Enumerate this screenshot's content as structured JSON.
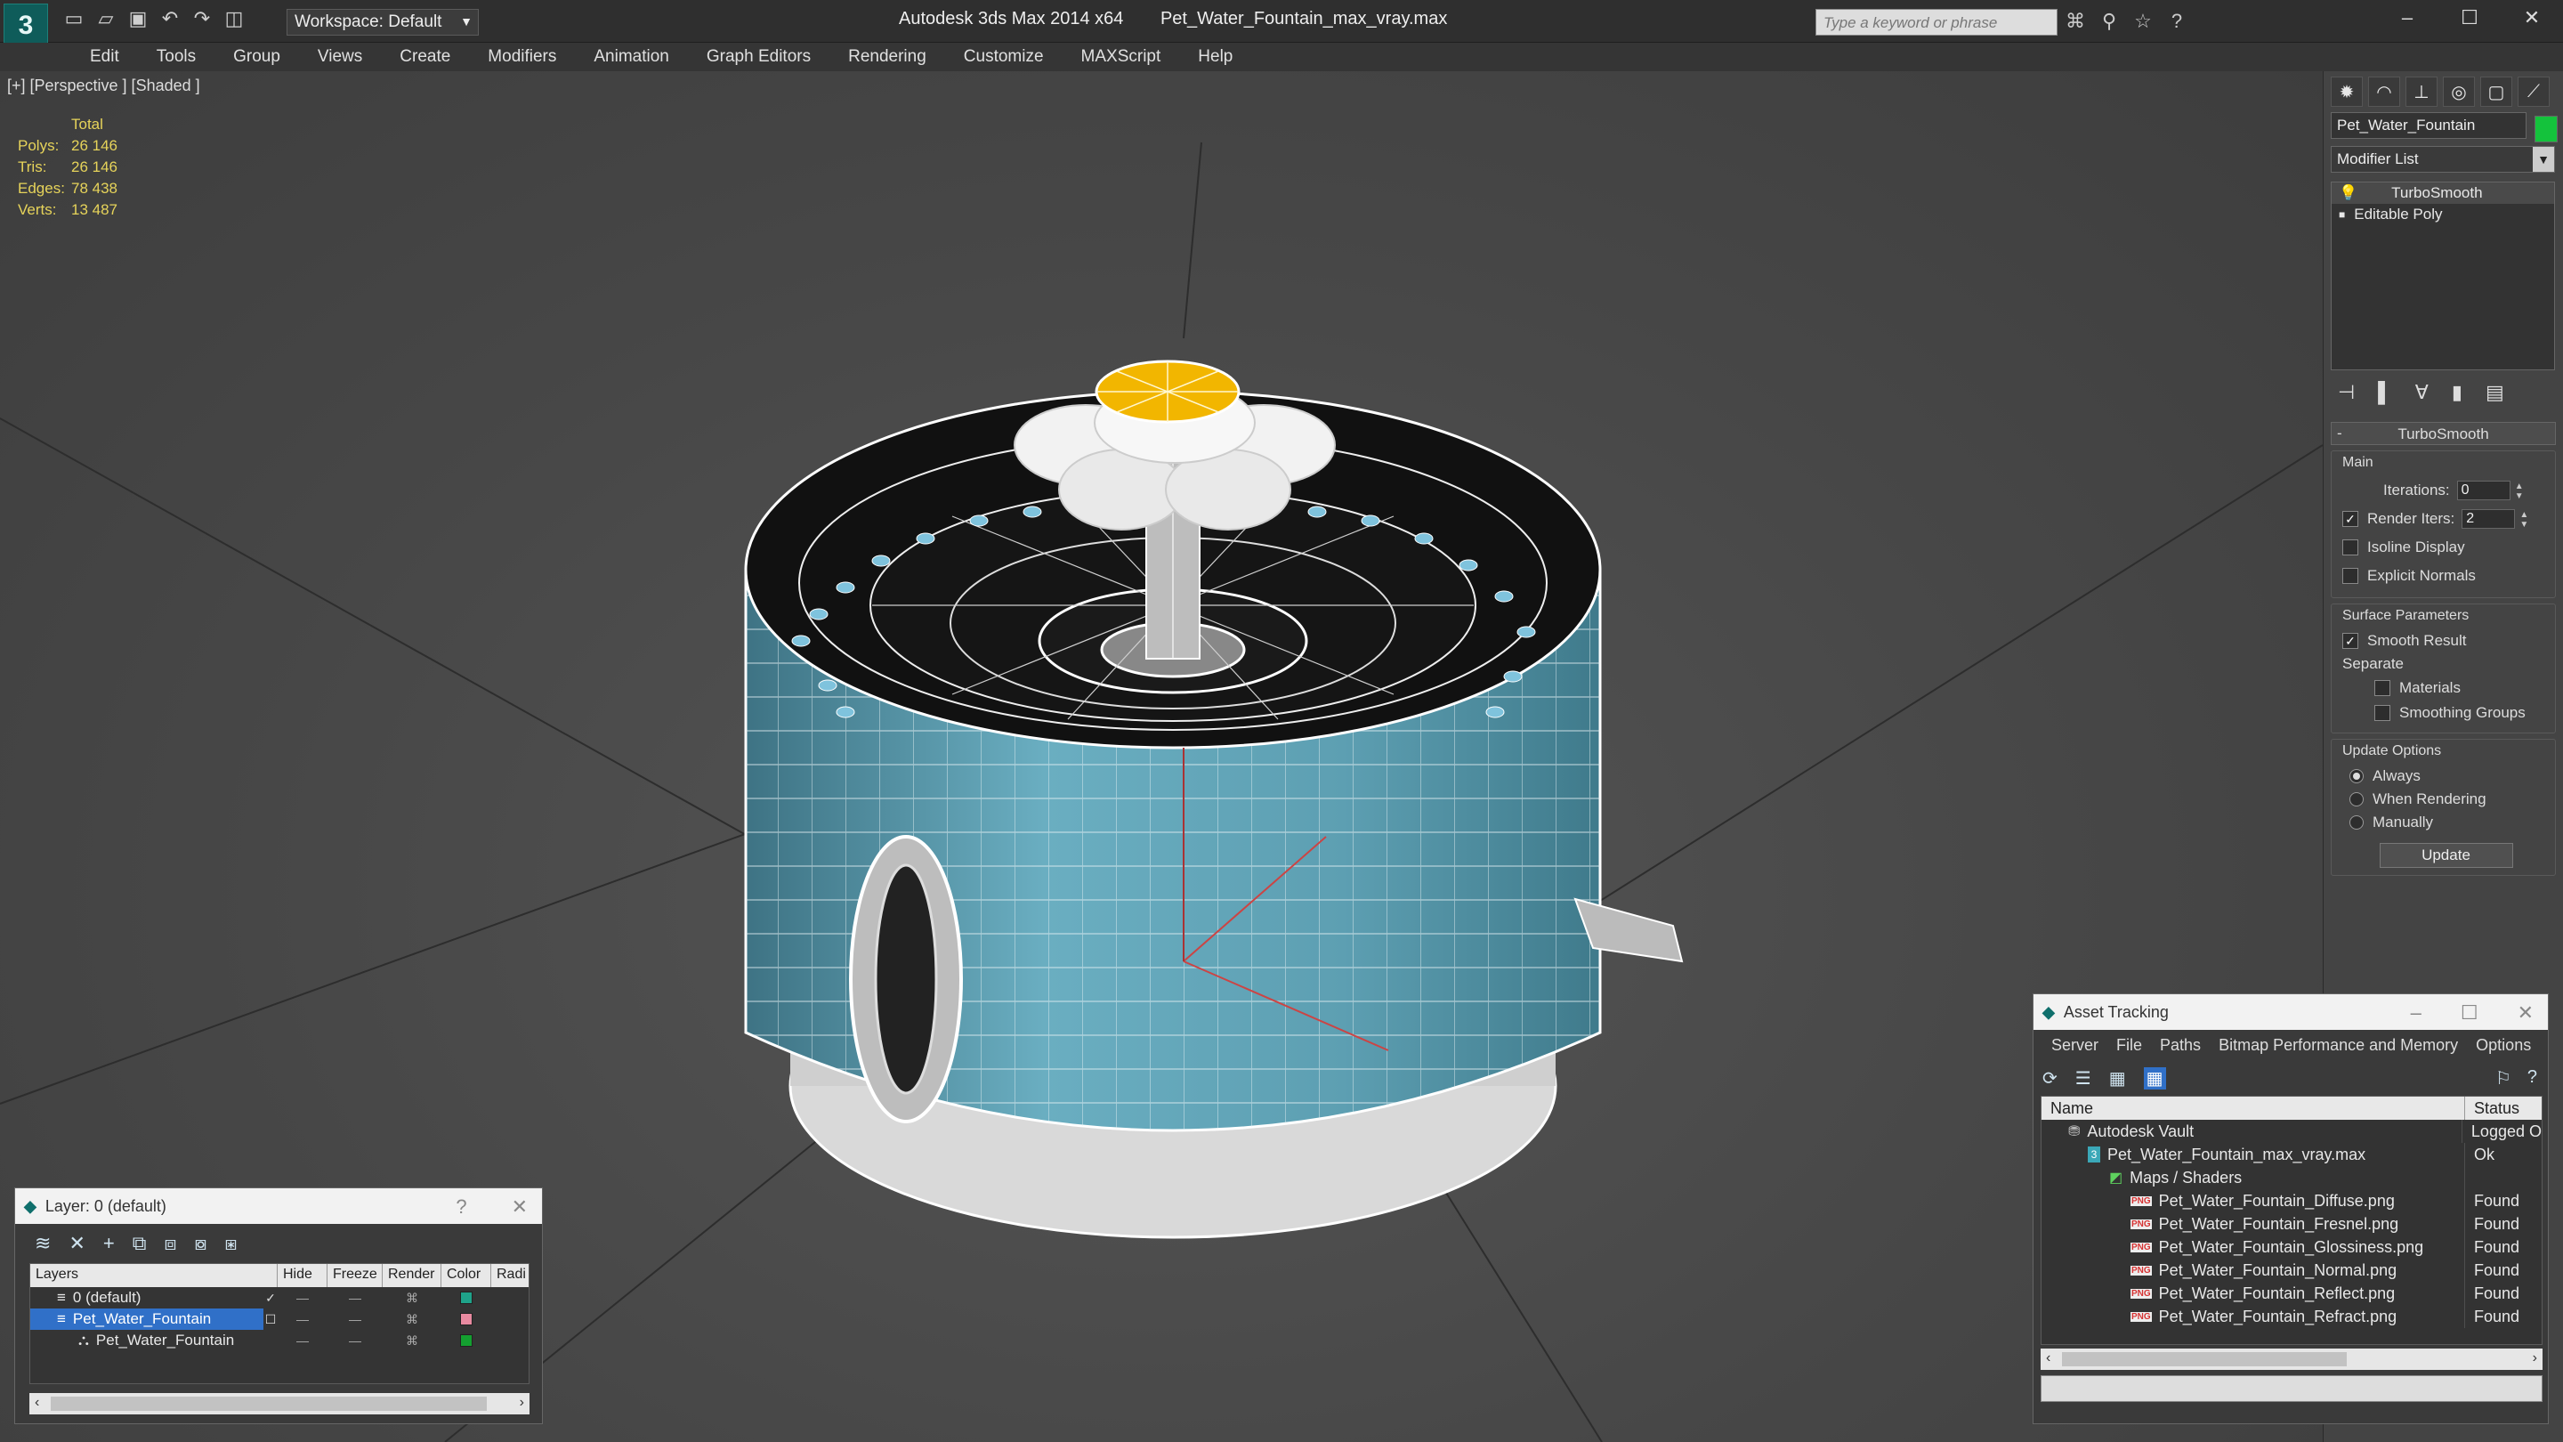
{
  "app": {
    "title": "Autodesk 3ds Max  2014 x64",
    "filename": "Pet_Water_Fountain_max_vray.max",
    "logo": "3ds-max-logo"
  },
  "toolbar": {
    "workspace": "Workspace: Default",
    "search_placeholder": "Type a keyword or phrase"
  },
  "menu": [
    "Edit",
    "Tools",
    "Group",
    "Views",
    "Create",
    "Modifiers",
    "Animation",
    "Graph Editors",
    "Rendering",
    "Customize",
    "MAXScript",
    "Help"
  ],
  "viewport": {
    "label": "[+] [Perspective ] [Shaded ]",
    "stats": {
      "header": "Total",
      "polys_label": "Polys:",
      "polys": "26 146",
      "tris_label": "Tris:",
      "tris": "26 146",
      "edges_label": "Edges:",
      "edges": "78 438",
      "verts_label": "Verts:",
      "verts": "13 487"
    },
    "colors": {
      "body": "#5e9fb2",
      "wire": "#ffffff",
      "flower": "#f2f2f2",
      "center": "#f0b400",
      "rim": "#111111"
    }
  },
  "command_panel": {
    "object_name": "Pet_Water_Fountain",
    "object_color": "#14c23c",
    "modifier_list": "Modifier List",
    "stack": [
      "TurboSmooth",
      "Editable Poly"
    ],
    "rollout": "TurboSmooth",
    "main": {
      "title": "Main",
      "iterations_label": "Iterations:",
      "iterations": "0",
      "render_iters_label": "Render Iters:",
      "render_iters": "2",
      "isoline_label": "Isoline Display",
      "explicit_label": "Explicit Normals"
    },
    "surface": {
      "title": "Surface Parameters",
      "smooth_label": "Smooth Result",
      "separate_label": "Separate",
      "materials_label": "Materials",
      "smoothing_label": "Smoothing Groups"
    },
    "update": {
      "title": "Update Options",
      "always": "Always",
      "when_rendering": "When Rendering",
      "manually": "Manually",
      "button": "Update"
    }
  },
  "layer_window": {
    "title": "Layer: 0 (default)",
    "help": "?",
    "columns": [
      "Layers",
      "Hide",
      "Freeze",
      "Render",
      "Color",
      "Radi"
    ],
    "rows": [
      {
        "name": "0 (default)",
        "color": "#1fa38a"
      },
      {
        "name": "Pet_Water_Fountain",
        "color": "#e88aa0"
      },
      {
        "name": "Pet_Water_Fountain",
        "color": "#14a030"
      }
    ]
  },
  "asset_window": {
    "title": "Asset Tracking",
    "menu": [
      "Server",
      "File",
      "Paths",
      "Bitmap Performance and Memory",
      "Options"
    ],
    "columns": {
      "name": "Name",
      "status": "Status"
    },
    "rows": [
      {
        "name": "Autodesk Vault",
        "status": "Logged O"
      },
      {
        "name": "Pet_Water_Fountain_max_vray.max",
        "status": "Ok"
      },
      {
        "name": "Maps / Shaders",
        "status": ""
      },
      {
        "name": "Pet_Water_Fountain_Diffuse.png",
        "status": "Found"
      },
      {
        "name": "Pet_Water_Fountain_Fresnel.png",
        "status": "Found"
      },
      {
        "name": "Pet_Water_Fountain_Glossiness.png",
        "status": "Found"
      },
      {
        "name": "Pet_Water_Fountain_Normal.png",
        "status": "Found"
      },
      {
        "name": "Pet_Water_Fountain_Reflect.png",
        "status": "Found"
      },
      {
        "name": "Pet_Water_Fountain_Refract.png",
        "status": "Found"
      }
    ]
  }
}
